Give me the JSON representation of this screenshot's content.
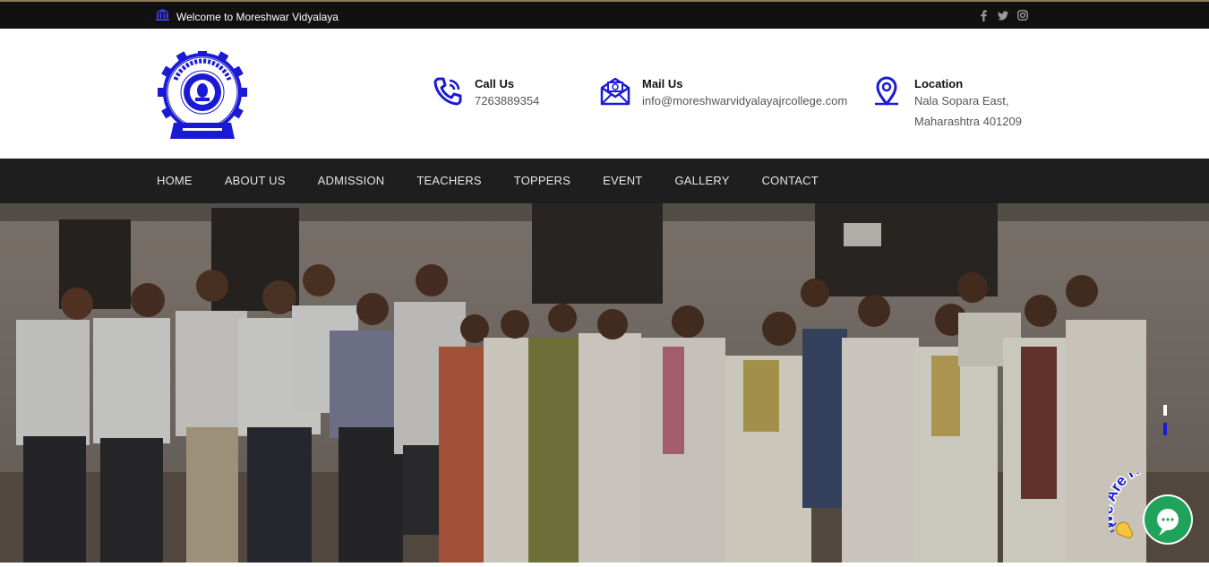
{
  "topbar": {
    "welcome_text": "Welcome to Moreshwar Vidyalaya",
    "icons": [
      "school-icon",
      "facebook-icon",
      "twitter-icon",
      "instagram-icon"
    ]
  },
  "header": {
    "logo_name": "school-logo",
    "call": {
      "title": "Call Us",
      "value": "7263889354",
      "icon": "phone-icon"
    },
    "mail": {
      "title": "Mail Us",
      "value": "info@moreshwarvidyalayajrcollege.com",
      "icon": "mail-icon"
    },
    "location": {
      "title": "Location",
      "line1": "Nala Sopara East,",
      "line2": "Maharashtra 401209",
      "icon": "location-pin-icon"
    }
  },
  "nav": {
    "items": [
      "HOME",
      "ABOUT US",
      "ADMISSION",
      "TEACHERS",
      "TOPPERS",
      "EVENT",
      "GALLERY",
      "CONTACT"
    ]
  },
  "hero": {
    "image": "staff-group-photo"
  },
  "chat": {
    "badge_text": "We Are Here!",
    "icon": "chat-bubble-icon"
  },
  "colors": {
    "accent": "#1a1ad6",
    "topbar": "#111111",
    "nav": "#1e1e1e",
    "chat": "#1fa35a"
  }
}
